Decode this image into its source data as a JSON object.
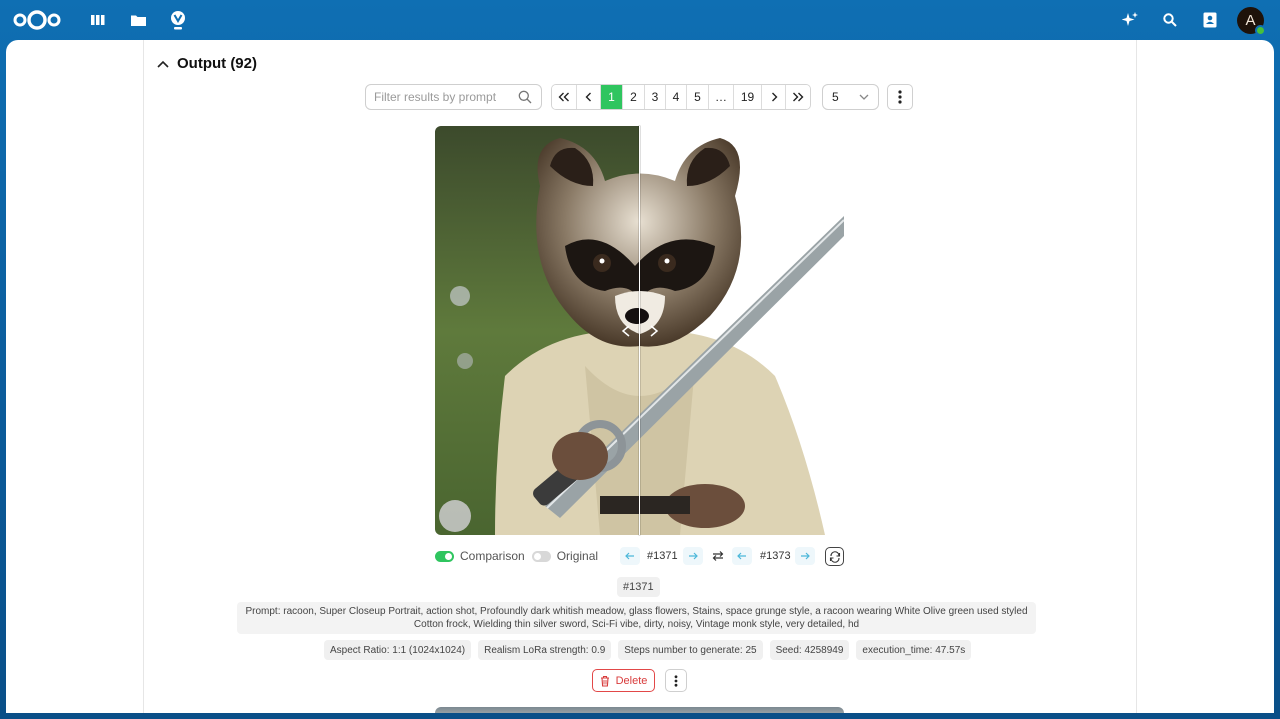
{
  "topbar": {
    "logo_label": "Nextcloud",
    "nav_icons": [
      "dashboard-icon",
      "files-icon",
      "visionatrix-icon"
    ],
    "right_icons": [
      "assistant-icon",
      "search-icon",
      "contacts-icon"
    ],
    "avatar_letter": "A",
    "status_color": "#46c03c"
  },
  "section": {
    "title": "Output (92)"
  },
  "filter": {
    "placeholder": "Filter results by prompt"
  },
  "pagination": {
    "first": "«",
    "prev": "‹",
    "pages": [
      "1",
      "2",
      "3",
      "4",
      "5",
      "…",
      "19"
    ],
    "active_page": "1",
    "next": "›",
    "last": "»"
  },
  "per_page": {
    "value": "5"
  },
  "comparison": {
    "comparison_label": "Comparison",
    "original_label": "Original",
    "comparison_on": true,
    "original_on": false,
    "left_id": "#1371",
    "right_id": "#1373"
  },
  "result": {
    "id": "#1371",
    "prompt": "Prompt: racoon, Super Closeup Portrait, action shot, Profoundly dark whitish meadow, glass flowers, Stains, space grunge style, a racoon wearing White Olive green used styled Cotton frock, Wielding thin silver sword, Sci-Fi vibe, dirty, noisy, Vintage monk style, very detailed, hd",
    "tags": [
      "Aspect Ratio: 1:1 (1024x1024)",
      "Realism LoRa strength: 0.9",
      "Steps number to generate: 25",
      "Seed: 4258949",
      "execution_time: 47.57s"
    ],
    "delete_label": "Delete"
  },
  "colors": {
    "accent": "#2fc55f",
    "header_blue": "#0f6fb3",
    "danger": "#e24848",
    "link_blue": "#4bb7d9"
  }
}
